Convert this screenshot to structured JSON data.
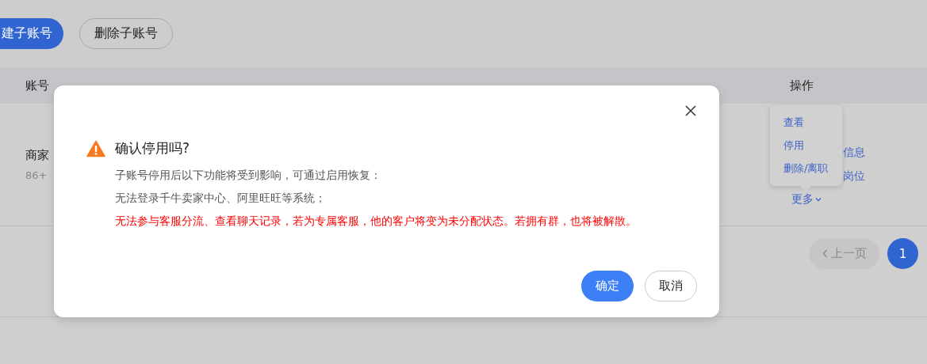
{
  "toolbar": {
    "buttons": [
      {
        "label": "建子账号",
        "kind": "primary"
      },
      {
        "label": "删除子账号",
        "kind": "default"
      }
    ]
  },
  "table": {
    "columns": [
      "账号",
      "操作"
    ],
    "rows": [
      {
        "account_name": "商家",
        "account_id": "86+",
        "actions": [
          "信息",
          "岗位"
        ],
        "more": "更多"
      }
    ]
  },
  "more_menu": {
    "items": [
      "查看",
      "停用",
      "删除/离职"
    ]
  },
  "pagination": {
    "prev": {
      "label": "上一页",
      "disabled": true
    },
    "pages": [
      {
        "label": "1",
        "selected": true
      }
    ]
  },
  "dialog": {
    "title": "确认停用吗?",
    "lines": [
      {
        "text": "子账号停用后以下功能将受到影响，可通过启用恢复：",
        "kind": "note"
      },
      {
        "text": "无法登录千牛卖家中心、阿里旺旺等系统；",
        "kind": "note"
      },
      {
        "text": "无法参与客服分流、查看聊天记录，若为专属客服，他的客户将变为未分配状态。若拥有群，也将被解散。",
        "kind": "warning"
      }
    ],
    "buttons": [
      {
        "label": "确定",
        "kind": "primary"
      },
      {
        "label": "取消",
        "kind": "default"
      }
    ]
  }
}
